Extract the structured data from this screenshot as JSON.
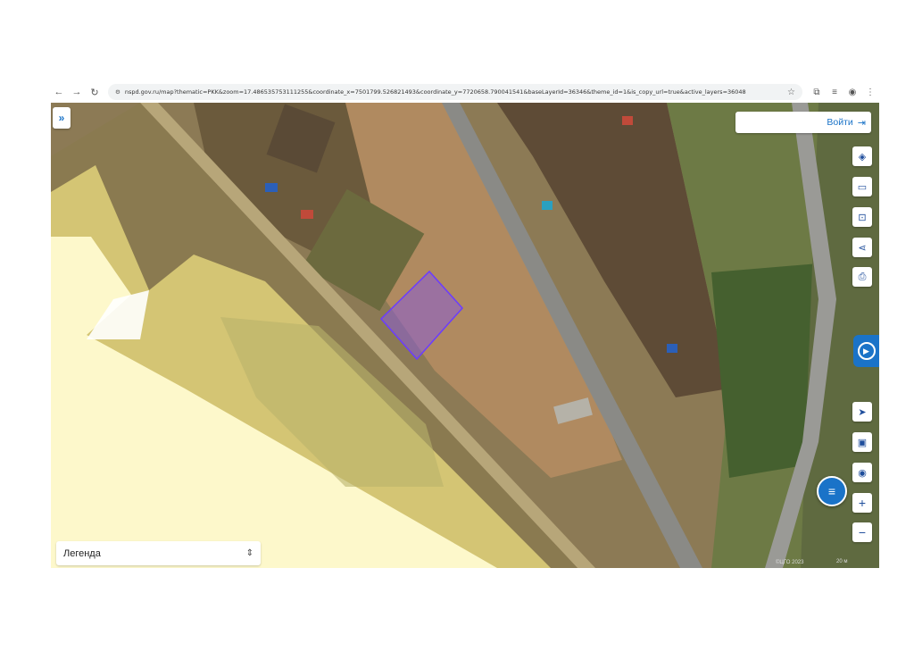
{
  "browser": {
    "back_icon": "arrow-left-icon",
    "forward_icon": "arrow-right-icon",
    "reload_icon": "reload-icon",
    "site_info_icon": "tune-icon",
    "url": "nspd.gov.ru/map?thematic=PKK&zoom=17.486535753111255&coordinate_x=7501799.526821493&coordinate_y=7720658.790041541&baseLayerId=36346&theme_id=1&is_copy_url=true&active_layers=36048",
    "bookmark_icon": "star-icon",
    "extensions_icon": "puzzle-icon",
    "media_icon": "media-icon",
    "profile_icon": "profile-icon",
    "menu_icon": "kebab-menu-icon"
  },
  "map": {
    "expand_icon": "double-chevron-right-icon",
    "login_label": "Войти",
    "login_icon": "login-icon",
    "tools": [
      {
        "name": "layers-icon"
      },
      {
        "name": "ruler-icon"
      },
      {
        "name": "search-area-icon"
      },
      {
        "name": "share-icon"
      },
      {
        "name": "print-icon"
      },
      {
        "name": "locate-icon"
      },
      {
        "name": "picture-icon"
      },
      {
        "name": "map-marker-icon"
      },
      {
        "name": "zoom-in-icon"
      },
      {
        "name": "zoom-out-icon"
      }
    ],
    "zoom_in_label": "+",
    "zoom_out_label": "−",
    "legend_label": "Легенда",
    "attribution": "©ЦГО 2023",
    "scale_label": "20 м",
    "colors": {
      "parcel_fill": "#8a5cd6",
      "parcel_stroke": "#6b3cff",
      "zone_light": "#fffbd0",
      "zone_dark": "#e0d27a",
      "accent": "#1a73c8"
    }
  }
}
